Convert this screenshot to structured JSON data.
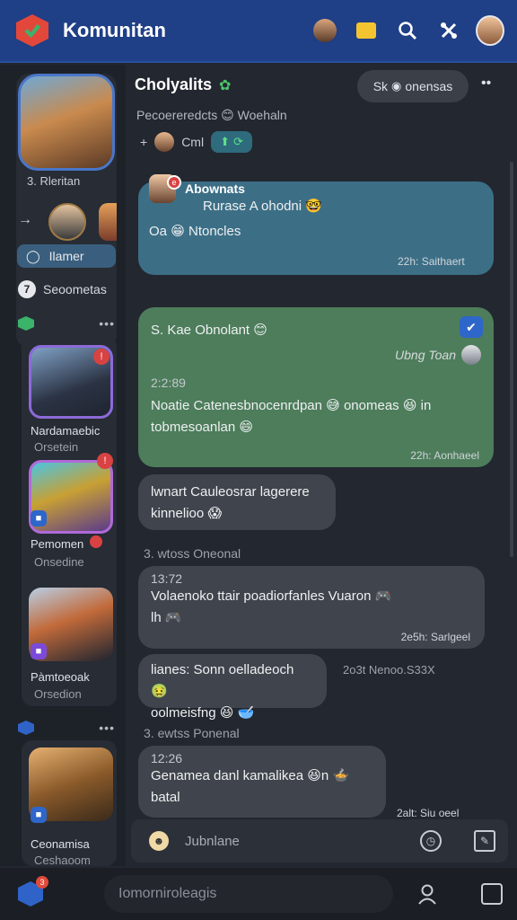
{
  "app": {
    "title": "Komunitan"
  },
  "header": {
    "chat_title": "Cholyalits",
    "filter_label": "Sk",
    "filter_text": "onensas",
    "subtitle": "Pecoereredcts",
    "subtitle_suffix": "Woehaln",
    "meta_prefix": "+",
    "meta_label": "Cml"
  },
  "rail": {
    "profile_name": "3. Rleritan",
    "pill_label": "Ilamer",
    "counter_label": "Seoometas",
    "counter_value": "7",
    "games": [
      {
        "name": "Nardamaebic",
        "sub": "Orsetein"
      },
      {
        "name": "Pemomen",
        "sub": "Onsedine"
      },
      {
        "name": "Pàmtoeoak",
        "sub": "Orsedion"
      },
      {
        "name": "Ceonamisa",
        "sub": "Ceshaoom"
      }
    ]
  },
  "messages": [
    {
      "sender": "Abownats",
      "line1": "Rurase A ohodni",
      "line2": "Oa",
      "line2b": "Ntoncles",
      "time": "22h: Saithaert"
    },
    {
      "line1": "S. Kae Obnolant",
      "reader": "Ubng Toan",
      "stamp": "2:2:89",
      "line2": "Noatie Catenesbnocenrdpan",
      "line2b": "onomeas",
      "line2c": "in",
      "line3": "tobmesoanlan",
      "time": "22h: Aonhaeel"
    },
    {
      "line1": "lwnart Cauleosrar lagerere",
      "line2": "kinnelioo"
    },
    {
      "date": "3. wtoss Oneonal"
    },
    {
      "stamp": "13:72",
      "line1": "Volaenoko ttair poadiorfanles Vuaron",
      "line2": "lh",
      "time": "2e5h: Sarlgeel"
    },
    {
      "line1": "lianes: Sonn oelladeoch",
      "line2": "oolmeisfng",
      "side": "2o3t Nenoo.S33X"
    },
    {
      "date": "3. ewtss Ponenal"
    },
    {
      "stamp": "12:26",
      "line1": "Genamea danl kamalikea",
      "line1b": "n",
      "line2": "batal",
      "time": "2alt: Siu oeel"
    }
  ],
  "composer": {
    "placeholder": "Jubnlane"
  },
  "bottom": {
    "search_placeholder": "Iomorniroleagis",
    "badge": "3"
  },
  "colors": {
    "topbar": "#1f3f86",
    "teal": "#3c6f86",
    "green": "#4d7d5b",
    "grey": "#40444c",
    "accent": "#2e66c9"
  }
}
